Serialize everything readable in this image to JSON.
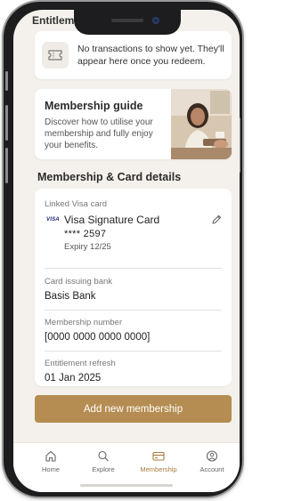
{
  "entitlements": {
    "title": "Entitlements",
    "empty_message": "No transactions to show yet. They'll appear here once you redeem."
  },
  "guide": {
    "title": "Membership guide",
    "description": "Discover how to utilise your membership and fully enjoy your benefits."
  },
  "details": {
    "section_title": "Membership & Card details",
    "linked_card_label": "Linked Visa card",
    "card_brand": "VISA",
    "card_name": "Visa Signature Card",
    "card_number": "**** 2597",
    "card_expiry": "Expiry 12/25",
    "issuing_bank_label": "Card issuing bank",
    "issuing_bank": "Basis Bank",
    "membership_number_label": "Membership number",
    "membership_number": "[0000 0000 0000 0000]",
    "entitlement_refresh_label": "Entitlement refresh",
    "entitlement_refresh": "01 Jan 2025"
  },
  "actions": {
    "add_membership": "Add new membership"
  },
  "tabs": [
    {
      "label": "Home",
      "icon": "home-icon"
    },
    {
      "label": "Explore",
      "icon": "search-icon"
    },
    {
      "label": "Membership",
      "icon": "card-icon",
      "active": true
    },
    {
      "label": "Account",
      "icon": "user-icon"
    }
  ],
  "colors": {
    "accent": "#b58d52",
    "active_tab": "#a67c3d",
    "background": "#f4f1ec"
  }
}
